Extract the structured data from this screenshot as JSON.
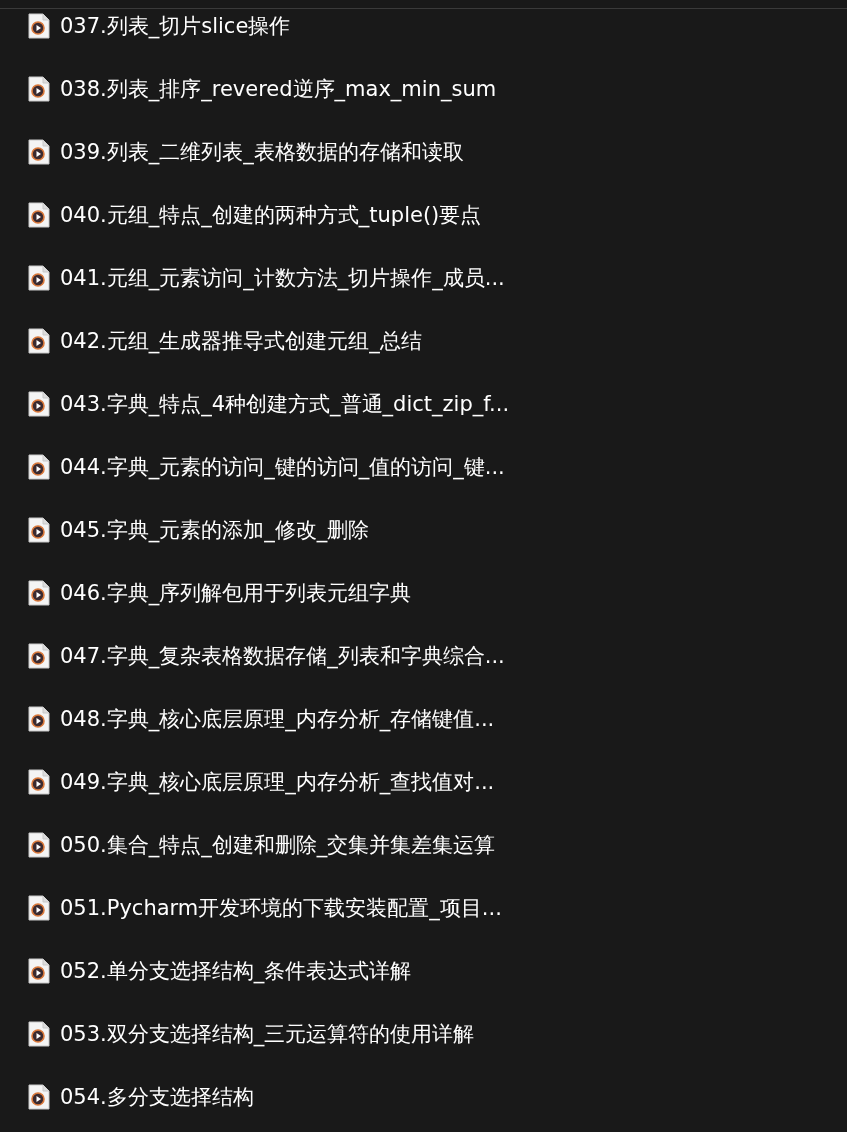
{
  "files": [
    {
      "name": "037.列表_切片slice操作"
    },
    {
      "name": "038.列表_排序_revered逆序_max_min_sum"
    },
    {
      "name": "039.列表_二维列表_表格数据的存储和读取"
    },
    {
      "name": "040.元组_特点_创建的两种方式_tuple()要点"
    },
    {
      "name": "041.元组_元素访问_计数方法_切片操作_成员..."
    },
    {
      "name": "042.元组_生成器推导式创建元组_总结"
    },
    {
      "name": "043.字典_特点_4种创建方式_普通_dict_zip_f..."
    },
    {
      "name": "044.字典_元素的访问_键的访问_值的访问_键..."
    },
    {
      "name": "045.字典_元素的添加_修改_删除"
    },
    {
      "name": "046.字典_序列解包用于列表元组字典"
    },
    {
      "name": "047.字典_复杂表格数据存储_列表和字典综合..."
    },
    {
      "name": "048.字典_核心底层原理_内存分析_存储键值..."
    },
    {
      "name": "049.字典_核心底层原理_内存分析_查找值对..."
    },
    {
      "name": "050.集合_特点_创建和删除_交集并集差集运算"
    },
    {
      "name": "051.Pycharm开发环境的下载安装配置_项目..."
    },
    {
      "name": "052.单分支选择结构_条件表达式详解"
    },
    {
      "name": "053.双分支选择结构_三元运算符的使用详解"
    },
    {
      "name": "054.多分支选择结构"
    }
  ]
}
